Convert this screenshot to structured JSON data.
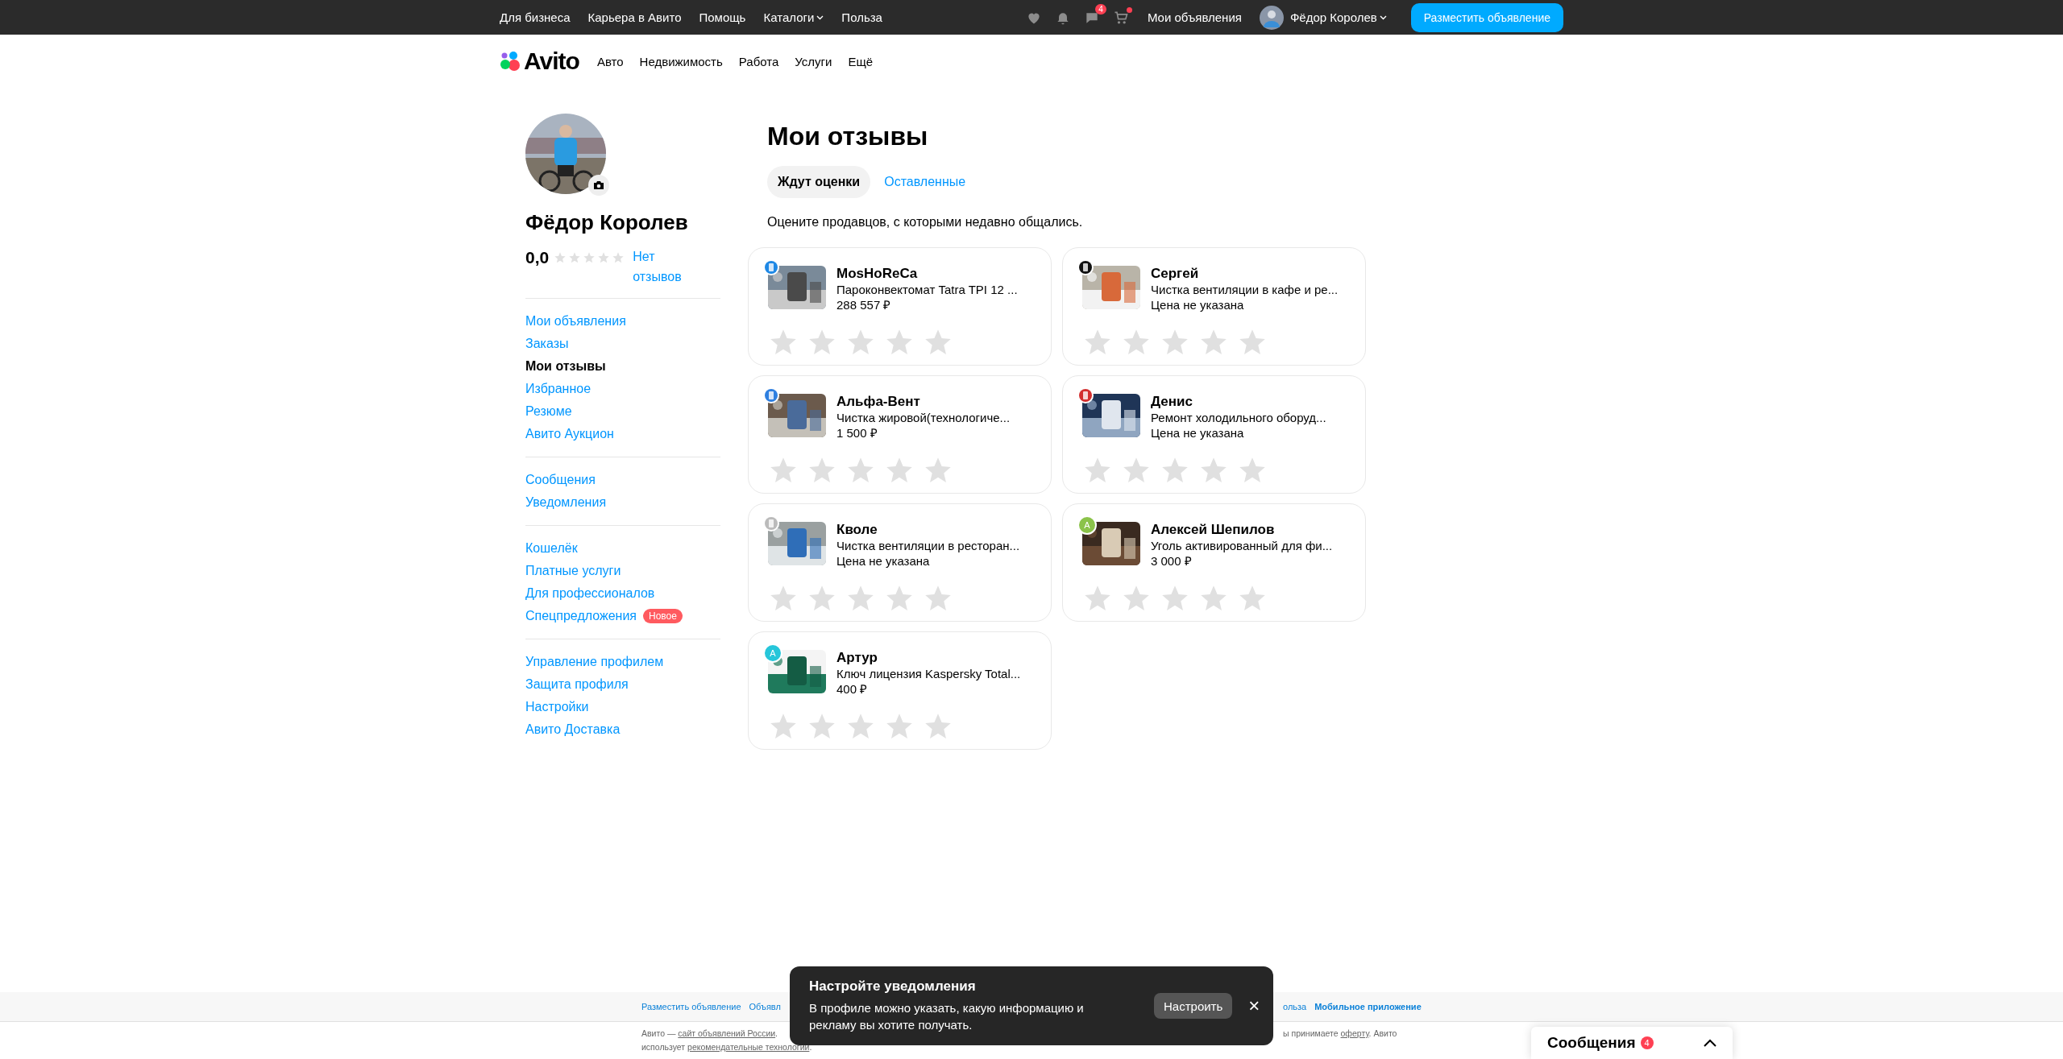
{
  "top_bar": {
    "links": [
      "Для бизнеса",
      "Карьера в Авито",
      "Помощь",
      "Каталоги",
      "Польза"
    ],
    "icons": [
      {
        "kind": "heart"
      },
      {
        "kind": "bell"
      },
      {
        "kind": "chat",
        "badge": "4"
      },
      {
        "kind": "cart",
        "dot": true
      }
    ],
    "my_ads": "Мои объявления",
    "user_name": "Фёдор Королев",
    "post_button": "Разместить объявление"
  },
  "header": {
    "logo": "Avito",
    "nav": [
      "Авто",
      "Недвижимость",
      "Работа",
      "Услуги",
      "Ещё"
    ]
  },
  "profile": {
    "name": "Фёдор Королев",
    "rating": "0,0",
    "stars": 0,
    "reviews_link": "Нет отзывов"
  },
  "sidebar": {
    "groups": [
      [
        {
          "label": "Мои объявления",
          "selected": false
        },
        {
          "label": "Заказы",
          "selected": false
        },
        {
          "label": "Мои отзывы",
          "selected": true
        },
        {
          "label": "Избранное",
          "selected": false
        },
        {
          "label": "Резюме",
          "selected": false
        },
        {
          "label": "Авито Аукцион",
          "selected": false
        }
      ],
      [
        {
          "label": "Сообщения",
          "selected": false
        },
        {
          "label": "Уведомления",
          "selected": false
        }
      ],
      [
        {
          "label": "Кошелёк",
          "selected": false
        },
        {
          "label": "Платные услуги",
          "selected": false
        },
        {
          "label": "Для профессионалов",
          "selected": false
        },
        {
          "label": "Спецпредложения",
          "selected": false,
          "badge": "Новое"
        }
      ],
      [
        {
          "label": "Управление профилем",
          "selected": false
        },
        {
          "label": "Защита профиля",
          "selected": false
        },
        {
          "label": "Настройки",
          "selected": false
        },
        {
          "label": "Авито Доставка",
          "selected": false
        }
      ]
    ]
  },
  "main": {
    "title": "Мои отзывы",
    "tabs": [
      {
        "label": "Ждут оценки",
        "selected": true
      },
      {
        "label": "Оставленные",
        "selected": false
      }
    ],
    "subtitle": "Оцените продавцов, с которыми недавно общались.",
    "cards": [
      {
        "seller": "MosHoReCa",
        "item": "Пароконвектомат Tatra TPI 12 ...",
        "price": "288 557 ₽",
        "stars": 0,
        "badge": {
          "kind": "logo",
          "color": "#1e88e5"
        }
      },
      {
        "seller": "Сергей",
        "item": "Чистка вентиляции в кафе и ре...",
        "price": "Цена не указана",
        "stars": 0,
        "badge": {
          "kind": "logo",
          "color": "#111111"
        }
      },
      {
        "seller": "Альфа-Вент",
        "item": "Чистка жировой(технологиче...",
        "price": "1 500 ₽",
        "stars": 0,
        "badge": {
          "kind": "logo",
          "color": "#2e7fe0"
        }
      },
      {
        "seller": "Денис",
        "item": "Ремонт холодильного оборуд...",
        "price": "Цена не указана",
        "stars": 0,
        "badge": {
          "kind": "logo",
          "color": "#d32f2f"
        }
      },
      {
        "seller": "Кволе",
        "item": "Чистка вентиляции в ресторан...",
        "price": "Цена не указана",
        "stars": 0,
        "badge": {
          "kind": "logo",
          "color": "#bbbbbb"
        }
      },
      {
        "seller": "Алексей Шепилов",
        "item": "Уголь активированный для фи...",
        "price": "3 000 ₽",
        "stars": 0,
        "badge": {
          "kind": "letter",
          "letter": "А",
          "color": "#8bc34a"
        }
      },
      {
        "seller": "Артур",
        "item": "Ключ лицензия Kaspersky Total...",
        "price": "400 ₽",
        "stars": 0,
        "badge": {
          "kind": "letter",
          "letter": "А",
          "color": "#26c6da"
        }
      }
    ]
  },
  "footer": {
    "links_left": [
      "Разместить объявление",
      "Объявл"
    ],
    "links_right": [
      {
        "label": "ольза",
        "bold": false
      },
      {
        "label": "Мобильное приложение",
        "bold": true
      }
    ],
    "legal_left": [
      {
        "text": "Авито — ",
        "link": false
      },
      {
        "text": "сайт объявлений России",
        "link": true
      },
      {
        "text": ".",
        "link": false
      }
    ],
    "legal_right": [
      {
        "text": "ы принимаете ",
        "link": false
      },
      {
        "text": "оферту",
        "link": true
      },
      {
        "text": ". Авито",
        "link": false
      }
    ],
    "legal_line2": [
      {
        "text": "использует ",
        "link": false
      },
      {
        "text": "рекомендательные технологии",
        "link": true
      },
      {
        "text": ".",
        "link": false
      }
    ]
  },
  "toast": {
    "title": "Настройте уведомления",
    "text": "В профиле можно указать, какую информацию и рекламу вы хотите получать.",
    "button": "Настроить",
    "close": "×"
  },
  "messenger": {
    "label": "Сообщения",
    "count": "4"
  }
}
